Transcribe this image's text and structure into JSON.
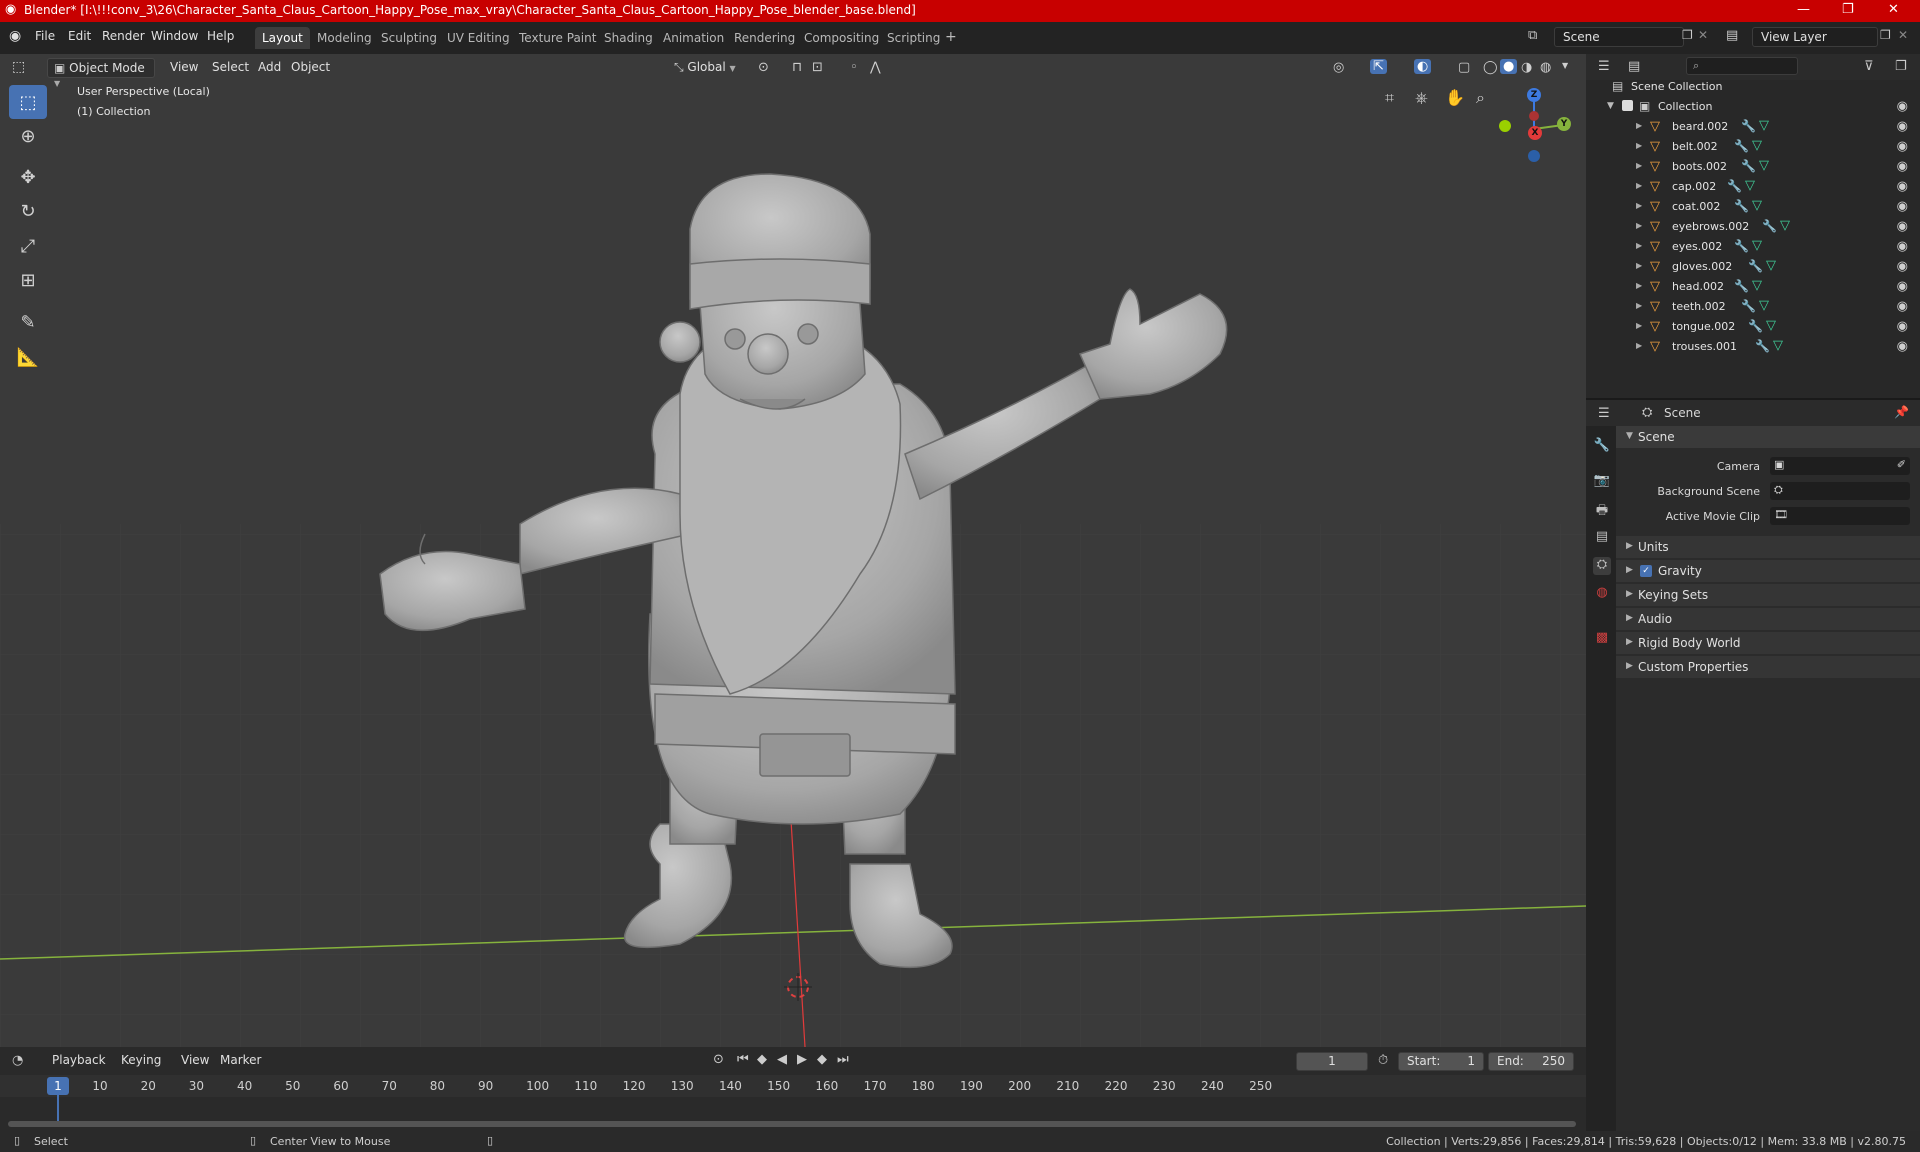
{
  "window": {
    "title": "Blender* [I:\\!!!conv_3\\26\\Character_Santa_Claus_Cartoon_Happy_Pose_max_vray\\Character_Santa_Claus_Cartoon_Happy_Pose_blender_base.blend]",
    "controls": [
      "—",
      "❐",
      "✕"
    ]
  },
  "menu": [
    "File",
    "Edit",
    "Render",
    "Window",
    "Help"
  ],
  "workspaces": [
    "Layout",
    "Modeling",
    "Sculpting",
    "UV Editing",
    "Texture Paint",
    "Shading",
    "Animation",
    "Rendering",
    "Compositing",
    "Scripting"
  ],
  "active_workspace": "Layout",
  "scene_field": "Scene",
  "view_layer_field": "View Layer",
  "viewport": {
    "mode": "Object Mode",
    "menus": [
      "View",
      "Select",
      "Add",
      "Object"
    ],
    "transform_orientation": "Global",
    "overlay_text_1": "User Perspective (Local)",
    "overlay_text_2": "(1) Collection",
    "gizmo": {
      "z": "Z",
      "y": "Y",
      "x": "X"
    },
    "colors": {
      "bg": "#3a3a3a",
      "accent": "#4772b3",
      "x_axis": "#e23a3a",
      "y_axis": "#86b33d",
      "z_axis": "#3d7ae0"
    }
  },
  "outliner": {
    "root": "Scene Collection",
    "collection": "Collection",
    "objects": [
      "beard.002",
      "belt.002",
      "boots.002",
      "cap.002",
      "coat.002",
      "eyebrows.002",
      "eyes.002",
      "gloves.002",
      "head.002",
      "teeth.002",
      "tongue.002",
      "trouses.001"
    ]
  },
  "properties": {
    "header": "Scene",
    "panel": "Scene",
    "fields": [
      "Camera",
      "Background Scene",
      "Active Movie Clip"
    ],
    "sections": [
      "Units",
      "Gravity",
      "Keying Sets",
      "Audio",
      "Rigid Body World",
      "Custom Properties"
    ],
    "gravity_checked": true
  },
  "timeline": {
    "menus": [
      "Playback",
      "Keying",
      "View",
      "Marker"
    ],
    "current_frame": "1",
    "start_label": "Start:",
    "start": "1",
    "end_label": "End:",
    "end": "250",
    "ticks": [
      "1",
      "10",
      "20",
      "30",
      "40",
      "50",
      "60",
      "70",
      "80",
      "90",
      "100",
      "110",
      "120",
      "130",
      "140",
      "150",
      "160",
      "170",
      "180",
      "190",
      "200",
      "210",
      "220",
      "230",
      "240",
      "250"
    ]
  },
  "status": {
    "left": "Select",
    "middle": "Center View to Mouse",
    "right": "Collection | Verts:29,856 | Faces:29,814 | Tris:59,628 | Objects:0/12 | Mem: 33.8 MB | v2.80.75"
  }
}
